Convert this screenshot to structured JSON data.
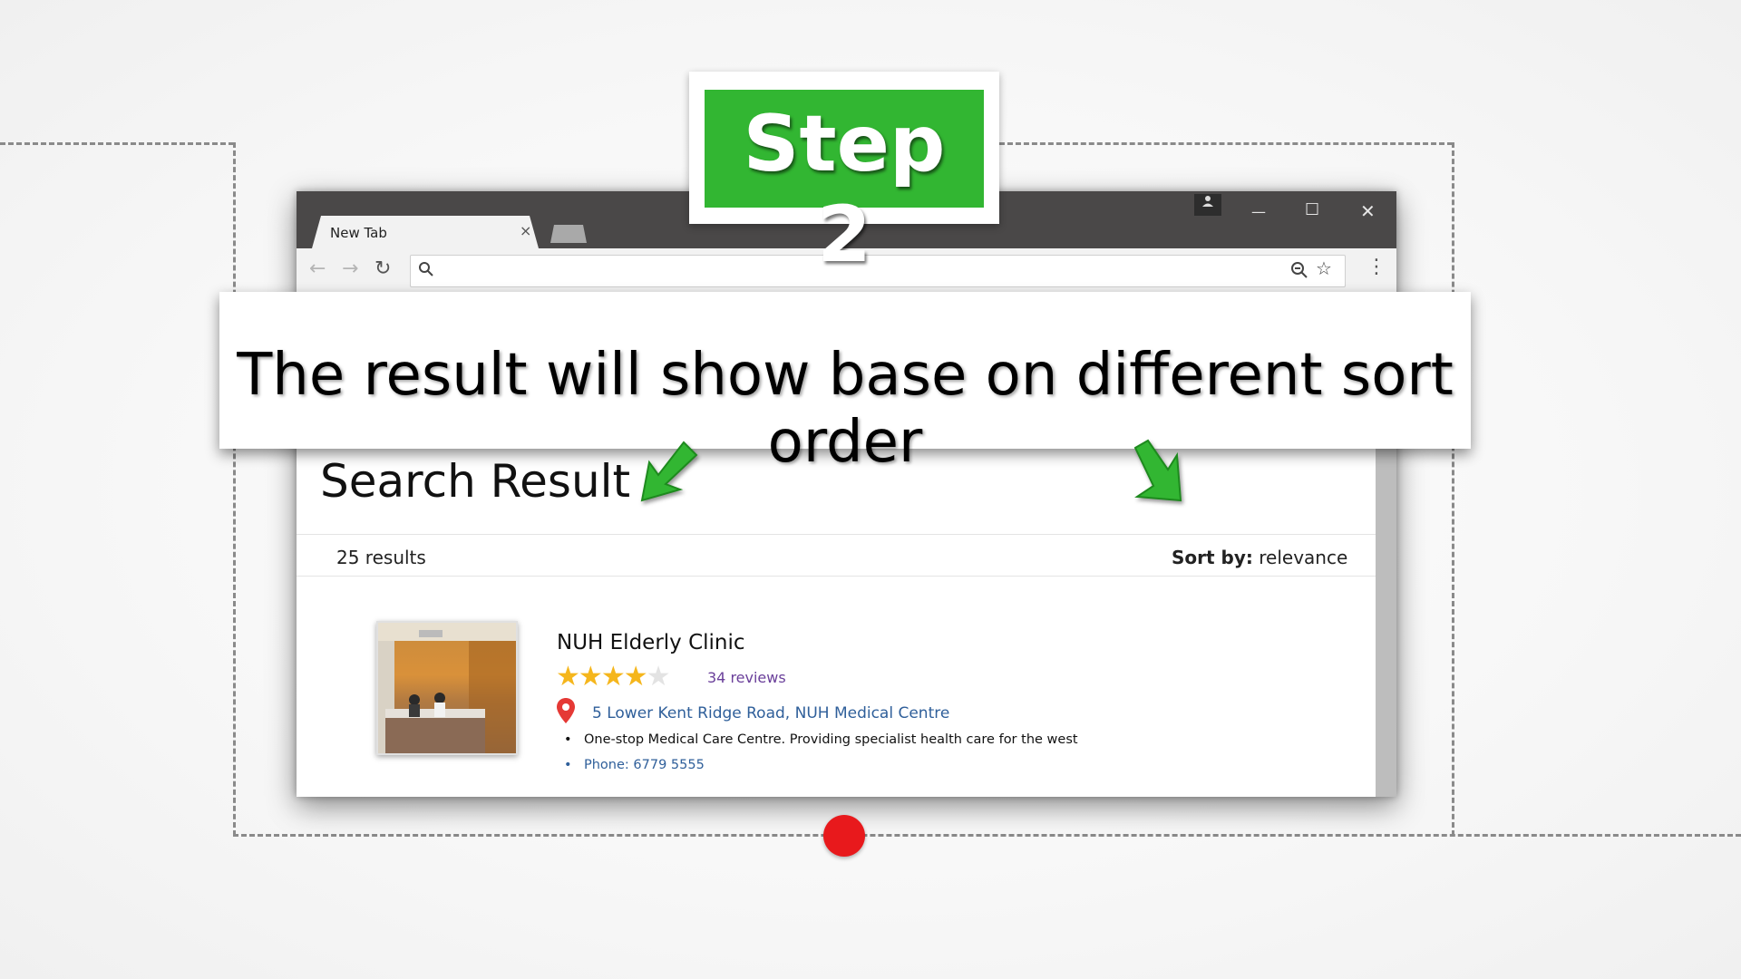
{
  "overlay": {
    "step_label": "Step 2",
    "banner_text": "The result will show base on different sort order"
  },
  "browser": {
    "tab_title": "New Tab",
    "tab_close": "×",
    "address_value": "",
    "window_controls": {
      "minimize": "—",
      "maximize": "☐",
      "close": "✕"
    }
  },
  "page": {
    "heading": "Search Result",
    "result_count": "25 results",
    "sort_label": "Sort by:",
    "sort_value": "relevance",
    "results": [
      {
        "name": "NUH Elderly Clinic",
        "rating": 4,
        "rating_max": 5,
        "reviews": "34 reviews",
        "address": "5 Lower Kent Ridge Road, NUH Medical Centre",
        "description": "One-stop Medical Care Centre. Providing specialist health care for the west",
        "phone": "Phone: 6779 5555"
      }
    ]
  },
  "colors": {
    "step_green": "#32b632",
    "arrow_green": "#32b632",
    "record_red": "#e8191c",
    "link_blue": "#2f5f9a",
    "review_purple": "#6a3f9a",
    "star_gold": "#f5b61c"
  },
  "icons": [
    "search-icon",
    "zoom-icon",
    "star-bookmark-icon",
    "menu-icon",
    "back-icon",
    "forward-icon",
    "reload-icon",
    "location-pin-icon",
    "profile-icon"
  ]
}
